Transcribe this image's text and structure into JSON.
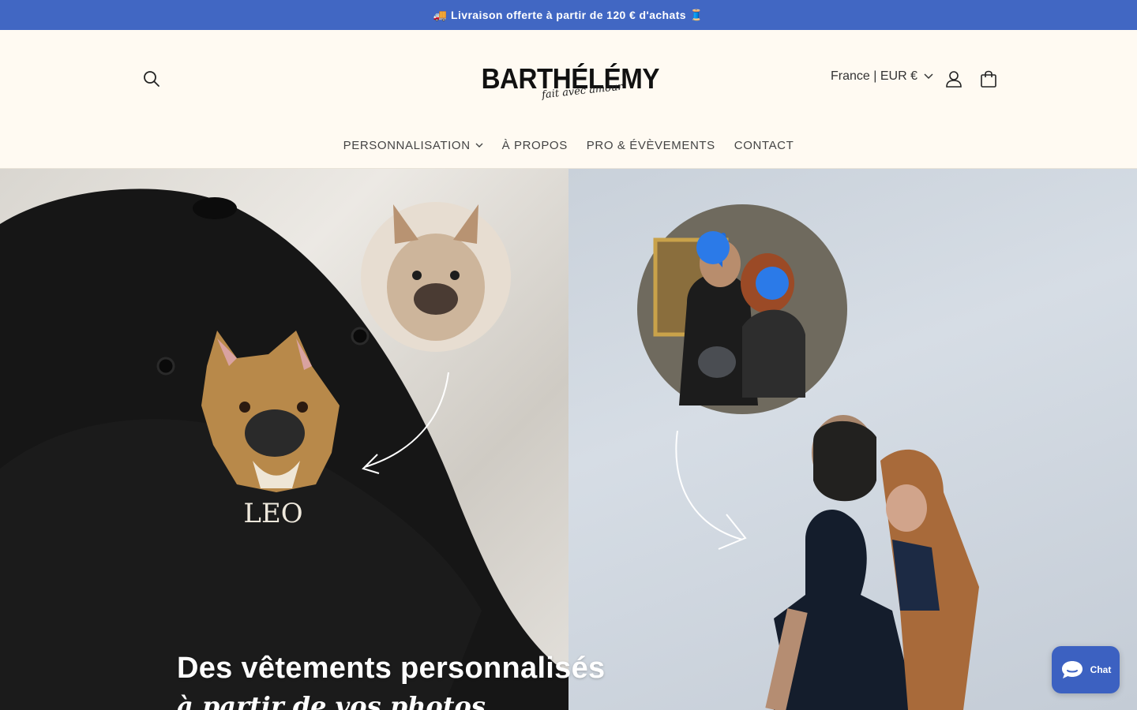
{
  "announcement": {
    "text": "🚚 Livraison offerte à partir de 120 € d'achats 🧵"
  },
  "header": {
    "logo_text": "BARTHÉLÉMY",
    "logo_tagline": "fait avec amour",
    "country_selector": "France | EUR €"
  },
  "nav": {
    "items": [
      {
        "label": "PERSONNALISATION",
        "has_dropdown": true
      },
      {
        "label": "À PROPOS"
      },
      {
        "label": "PRO & ÉVÈVEMENTS"
      },
      {
        "label": "CONTACT"
      }
    ]
  },
  "hero": {
    "cap_text": "LEO",
    "title": "Des vêtements personnalisés",
    "subtitle": "à partir de vos photos"
  },
  "chat": {
    "label": "Chat"
  },
  "colors": {
    "announcement_bg": "#4167c3",
    "header_bg": "#fffaf2",
    "chat_bg": "#3c61c1"
  }
}
